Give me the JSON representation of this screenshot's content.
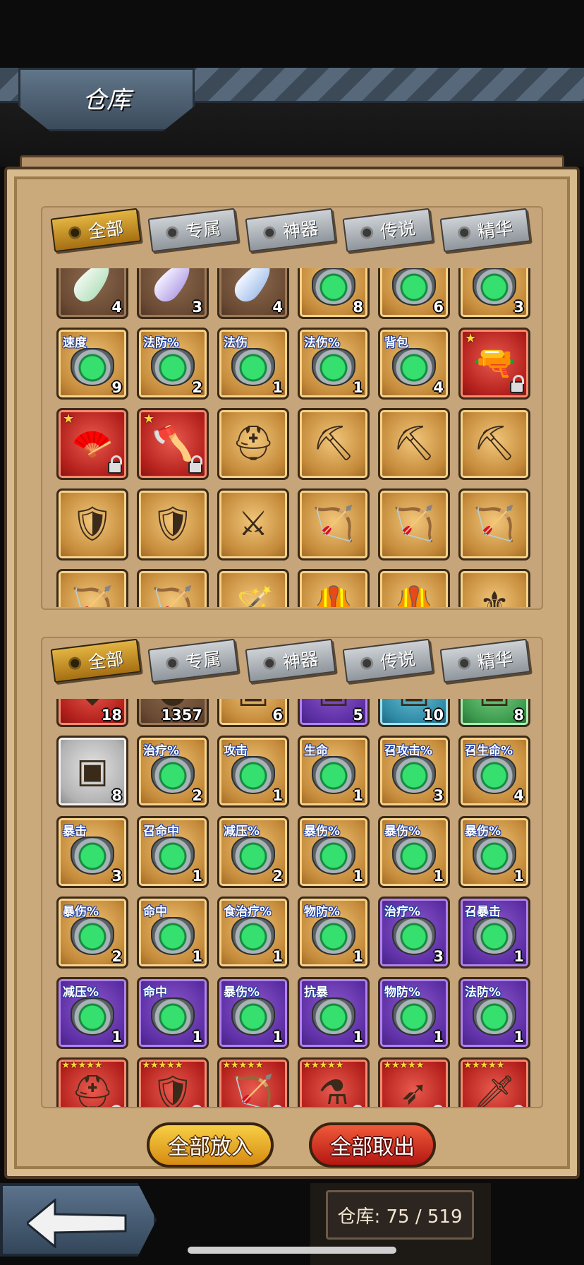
{
  "header": {
    "title": "仓库"
  },
  "top_panel": {
    "tabs": [
      {
        "label": "全部",
        "active": true
      },
      {
        "label": "专属",
        "active": false
      },
      {
        "label": "神器",
        "active": false
      },
      {
        "label": "传说",
        "active": false
      },
      {
        "label": "精华",
        "active": false
      }
    ],
    "rows": [
      [
        {
          "kind": "feather",
          "color": "green",
          "qty": "4",
          "frame": "brown"
        },
        {
          "kind": "feather",
          "color": "purple",
          "qty": "3",
          "frame": "brown"
        },
        {
          "kind": "feather",
          "color": "blue",
          "qty": "4",
          "frame": "brown"
        },
        {
          "kind": "gem",
          "qty": "8",
          "frame": "gold"
        },
        {
          "kind": "gem",
          "qty": "6",
          "frame": "gold"
        },
        {
          "kind": "gem",
          "qty": "3",
          "frame": "gold"
        }
      ],
      [
        {
          "kind": "gem",
          "tag": "速度",
          "qty": "9",
          "frame": "gold"
        },
        {
          "kind": "gem",
          "tag": "法防%",
          "qty": "2",
          "frame": "gold"
        },
        {
          "kind": "gem",
          "tag": "法伤",
          "qty": "1",
          "frame": "gold"
        },
        {
          "kind": "gem",
          "tag": "法伤%",
          "qty": "1",
          "frame": "gold"
        },
        {
          "kind": "gem",
          "tag": "背包",
          "qty": "4",
          "frame": "gold"
        },
        {
          "kind": "gun-icon",
          "star": true,
          "lock": true,
          "frame": "red"
        }
      ],
      [
        {
          "kind": "fan-icon",
          "star": true,
          "lock": true,
          "frame": "red"
        },
        {
          "kind": "axe-icon",
          "star": true,
          "lock": true,
          "frame": "red"
        },
        {
          "kind": "helmet-icon",
          "frame": "gold"
        },
        {
          "kind": "pickaxe-icon",
          "frame": "gold"
        },
        {
          "kind": "pickaxe-icon",
          "frame": "gold"
        },
        {
          "kind": "pickaxe-icon",
          "frame": "gold"
        }
      ],
      [
        {
          "kind": "shield-icon",
          "frame": "gold"
        },
        {
          "kind": "shield-icon",
          "frame": "gold"
        },
        {
          "kind": "swords-icon",
          "frame": "gold"
        },
        {
          "kind": "bow-icon",
          "frame": "gold"
        },
        {
          "kind": "bow-icon",
          "frame": "gold"
        },
        {
          "kind": "bow-icon",
          "frame": "gold"
        }
      ],
      [
        {
          "kind": "crossbow-icon",
          "frame": "gold"
        },
        {
          "kind": "crossbow-icon",
          "frame": "gold"
        },
        {
          "kind": "wand-icon",
          "frame": "gold"
        },
        {
          "kind": "armor-icon",
          "frame": "gold"
        },
        {
          "kind": "armor-icon",
          "frame": "gold"
        },
        {
          "kind": "emblem-icon",
          "frame": "gold"
        }
      ]
    ]
  },
  "bottom_panel": {
    "tabs": [
      {
        "label": "全部",
        "active": true
      },
      {
        "label": "专属",
        "active": false
      },
      {
        "label": "神器",
        "active": false
      },
      {
        "label": "传说",
        "active": false
      },
      {
        "label": "精华",
        "active": false
      }
    ],
    "rows": [
      [
        {
          "kind": "crystal-icon",
          "qty": "18",
          "frame": "red"
        },
        {
          "kind": "coin-icon",
          "qty": "1357",
          "frame": "brown"
        },
        {
          "kind": "chest-icon",
          "qty": "6",
          "frame": "gold"
        },
        {
          "kind": "chest-icon",
          "qty": "5",
          "frame": "purple"
        },
        {
          "kind": "chest-icon",
          "qty": "10",
          "frame": "teal"
        },
        {
          "kind": "chest-icon",
          "qty": "8",
          "frame": "green"
        }
      ],
      [
        {
          "kind": "chest-icon",
          "qty": "8",
          "frame": "grey"
        },
        {
          "kind": "gem",
          "tag": "治疗%",
          "qty": "2",
          "frame": "gold"
        },
        {
          "kind": "gem",
          "tag": "攻击",
          "qty": "1",
          "frame": "gold"
        },
        {
          "kind": "gem",
          "tag": "生命",
          "qty": "1",
          "frame": "gold"
        },
        {
          "kind": "gem",
          "tag": "召攻击%",
          "qty": "3",
          "frame": "gold"
        },
        {
          "kind": "gem",
          "tag": "召生命%",
          "qty": "4",
          "frame": "gold"
        }
      ],
      [
        {
          "kind": "gem",
          "tag": "暴击",
          "qty": "3",
          "frame": "gold"
        },
        {
          "kind": "gem",
          "tag": "召命中",
          "qty": "1",
          "frame": "gold"
        },
        {
          "kind": "gem",
          "tag": "减压%",
          "qty": "2",
          "frame": "gold"
        },
        {
          "kind": "gem",
          "tag": "暴伤%",
          "qty": "1",
          "frame": "gold"
        },
        {
          "kind": "gem",
          "tag": "暴伤%",
          "qty": "1",
          "frame": "gold"
        },
        {
          "kind": "gem",
          "tag": "暴伤%",
          "qty": "1",
          "frame": "gold"
        }
      ],
      [
        {
          "kind": "gem",
          "tag": "暴伤%",
          "qty": "2",
          "frame": "gold"
        },
        {
          "kind": "gem",
          "tag": "命中",
          "qty": "1",
          "frame": "gold"
        },
        {
          "kind": "gem",
          "tag": "食治疗%",
          "qty": "1",
          "frame": "gold"
        },
        {
          "kind": "gem",
          "tag": "物防%",
          "qty": "1",
          "frame": "gold"
        },
        {
          "kind": "gem",
          "tag": "治疗%",
          "qty": "3",
          "frame": "purple"
        },
        {
          "kind": "gem",
          "tag": "召暴击",
          "qty": "1",
          "frame": "purple"
        }
      ],
      [
        {
          "kind": "gem",
          "tag": "减压%",
          "qty": "1",
          "frame": "purple"
        },
        {
          "kind": "gem",
          "tag": "命中",
          "qty": "1",
          "frame": "purple"
        },
        {
          "kind": "gem",
          "tag": "暴伤%",
          "qty": "1",
          "frame": "purple"
        },
        {
          "kind": "gem",
          "tag": "抗暴",
          "qty": "1",
          "frame": "purple"
        },
        {
          "kind": "gem",
          "tag": "物防%",
          "qty": "1",
          "frame": "purple"
        },
        {
          "kind": "gem",
          "tag": "法防%",
          "qty": "1",
          "frame": "purple"
        }
      ],
      [
        {
          "kind": "helmet-icon",
          "stars": "★★★★★",
          "lock": true,
          "frame": "red"
        },
        {
          "kind": "shield-icon",
          "stars": "★★★★★",
          "lock": true,
          "frame": "red"
        },
        {
          "kind": "bow-icon",
          "stars": "★★★★★",
          "lock": true,
          "frame": "red"
        },
        {
          "kind": "potion-icon",
          "stars": "★★★★★",
          "lock": true,
          "frame": "red"
        },
        {
          "kind": "spear-icon",
          "stars": "★★★★★",
          "lock": true,
          "frame": "red"
        },
        {
          "kind": "sword-icon",
          "stars": "★★★★★",
          "lock": true,
          "frame": "red"
        }
      ]
    ]
  },
  "buttons": {
    "put_all": "全部放入",
    "take_all": "全部取出"
  },
  "footer": {
    "storage_count": "仓库: 75 / 519"
  },
  "icons": {
    "back": "back-arrow-icon"
  }
}
